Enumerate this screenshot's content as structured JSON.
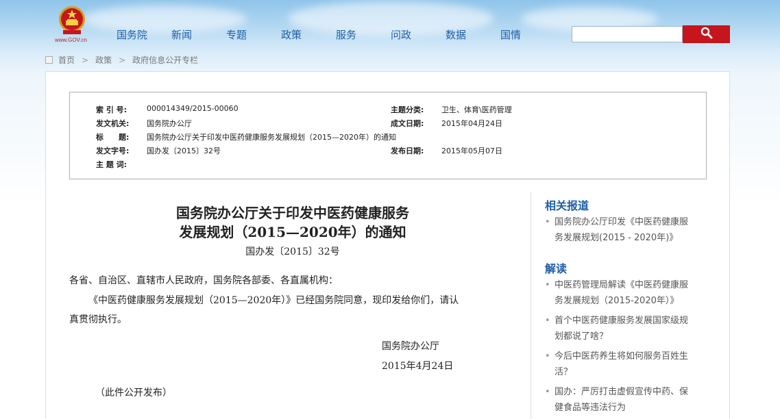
{
  "site": {
    "domain": "www.GOV.cn"
  },
  "nav": [
    "国务院",
    "新闻",
    "专题",
    "政策",
    "服务",
    "问政",
    "数据",
    "国情"
  ],
  "search": {
    "placeholder": ""
  },
  "breadcrumb": [
    "首页",
    "政策",
    "政府信息公开专栏"
  ],
  "meta": {
    "index_label": "索 引 号:",
    "index_value": "000014349/2015-00060",
    "category_label": "主题分类:",
    "category_value": "卫生、体育\\医药管理",
    "issuer_label": "发文机关:",
    "issuer_value": "国务院办公厅",
    "written_label": "成文日期:",
    "written_value": "2015年04月24日",
    "title_label": "标　　题:",
    "title_value": "国务院办公厅关于印发中医药健康服务发展规划（2015—2020年）的通知",
    "docnum_label": "发文字号:",
    "docnum_value": "国办发〔2015〕32号",
    "published_label": "发布日期:",
    "published_value": "2015年05月07日",
    "keywords_label": "主 题 词:",
    "keywords_value": ""
  },
  "article": {
    "title_line1": "国务院办公厅关于印发中医药健康服务",
    "title_line2": "发展规划（2015—2020年）的通知",
    "doc_number": "国办发〔2015〕32号",
    "addressee": "各省、自治区、直辖市人民政府，国务院各部委、各直属机构：",
    "para1_line1": "《中医药健康服务发展规划（2015—2020年）》已经国务院同意，现印发给你们，请认",
    "para1_line2": "真贯彻执行。",
    "signature": "国务院办公厅",
    "date": "2015年4月24日",
    "note": "（此件公开发布）"
  },
  "sidebar": {
    "related_title": "相关报道",
    "related": [
      {
        "line1": "国务院办公厅印发《中医药健康服",
        "line2": "务发展规划(2015 - 2020年)》"
      }
    ],
    "interpret_title": "解读",
    "interpret": [
      {
        "line1": "中医药管理局解读《中医药健康服",
        "line2": "务发展规划（2015-2020年）》"
      },
      {
        "line1": "首个中医药健康服务发展国家级规",
        "line2": "划都说了啥？"
      },
      {
        "line1": "今后中医药养生将如何服务百姓生",
        "line2": "活？"
      },
      {
        "line1": "国办：严厉打击虚假宣传中药、保",
        "line2": "健食品等违法行为"
      }
    ]
  },
  "colors": {
    "nav": "#1f5fa8",
    "search_button": "#c4161c",
    "emblem": "#c4161c"
  }
}
